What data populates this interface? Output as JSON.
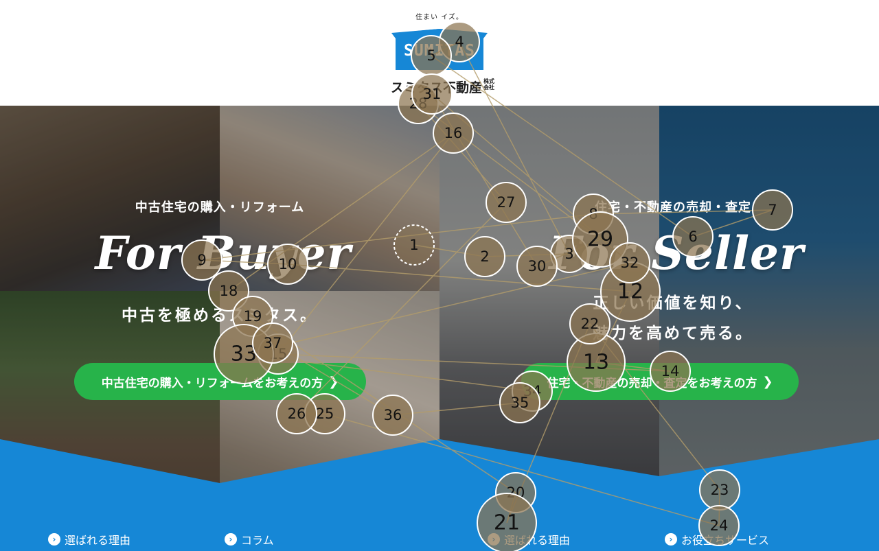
{
  "header": {
    "tagline": "住まい イズ。",
    "logo_word": "SUMITAS",
    "company_name": "スミタス不動産",
    "company_suffix_line1": "株式",
    "company_suffix_line2": "会社",
    "logo_color": "#1687d6"
  },
  "buyer": {
    "subtitle": "中古住宅の購入・リフォーム",
    "title": "For Buyer",
    "tagline": "中古を極めるスミタス。",
    "cta_label": "中古住宅の購入・リフォームをお考えの方"
  },
  "seller": {
    "subtitle": "住宅・不動産の売却・査定",
    "title": "For Seller",
    "tagline_line1": "正しい価値を知り、",
    "tagline_line2": "魅力を高めて売る。",
    "cta_label": "住宅・不動産の売却・査定をお考えの方"
  },
  "bottom_nav": [
    {
      "label": "選ばれる理由"
    },
    {
      "label": "コラム"
    },
    {
      "label": "選ばれる理由"
    },
    {
      "label": "お役立ちサービス"
    }
  ],
  "colors": {
    "cta_green": "#27b34a",
    "band_blue": "#1687d6",
    "fixation_fill": "#8c7550",
    "scanpath_line": "#b39c6a"
  },
  "gaze_fixations": [
    {
      "n": "1"
    },
    {
      "n": "2"
    },
    {
      "n": "3"
    },
    {
      "n": "4"
    },
    {
      "n": "5"
    },
    {
      "n": "6"
    },
    {
      "n": "7"
    },
    {
      "n": "8"
    },
    {
      "n": "9"
    },
    {
      "n": "10"
    },
    {
      "n": "12"
    },
    {
      "n": "13"
    },
    {
      "n": "14"
    },
    {
      "n": "15"
    },
    {
      "n": "16"
    },
    {
      "n": "18"
    },
    {
      "n": "19"
    },
    {
      "n": "20"
    },
    {
      "n": "21"
    },
    {
      "n": "22"
    },
    {
      "n": "23"
    },
    {
      "n": "24"
    },
    {
      "n": "25"
    },
    {
      "n": "26"
    },
    {
      "n": "27"
    },
    {
      "n": "28"
    },
    {
      "n": "29"
    },
    {
      "n": "30"
    },
    {
      "n": "31"
    },
    {
      "n": "32"
    },
    {
      "n": "33"
    },
    {
      "n": "34"
    },
    {
      "n": "35"
    },
    {
      "n": "36"
    },
    {
      "n": "37"
    }
  ]
}
